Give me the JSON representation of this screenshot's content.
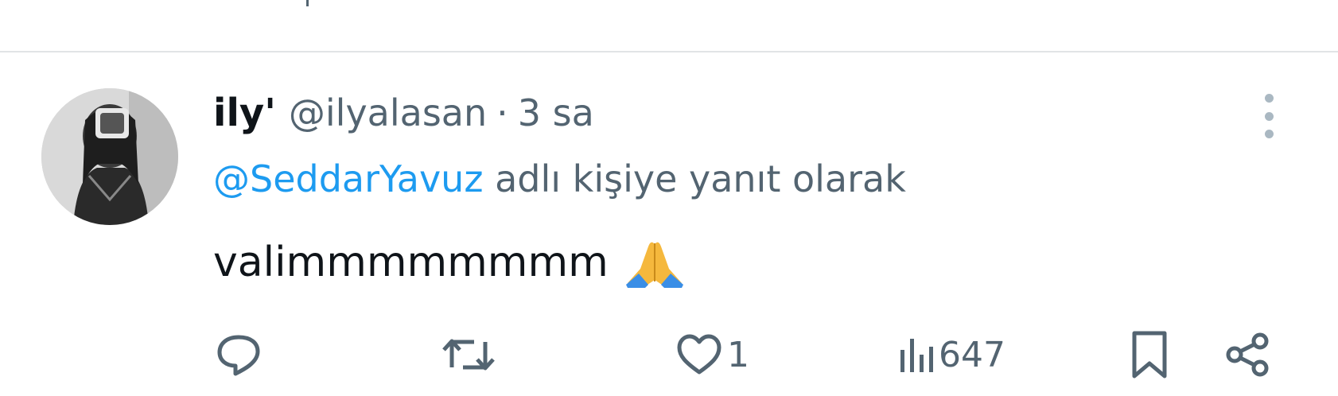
{
  "tweet": {
    "display_name": "ily'",
    "handle": "@ilyalasan",
    "separator": "·",
    "time": "3 sa",
    "reply_mention": "@SeddarYavuz",
    "reply_suffix": "adlı kişiye yanıt olarak",
    "text": "valimmmmmmmm",
    "emoji": "folded-hands-emoji"
  },
  "actions": {
    "reply_icon": "comment-icon",
    "retweet_icon": "retweet-icon",
    "like_icon": "heart-icon",
    "like_count": "1",
    "views_icon": "analytics-icon",
    "views_count": "647",
    "bookmark_icon": "bookmark-icon",
    "share_icon": "share-icon"
  },
  "colors": {
    "mention": "#1d9bf0",
    "secondary_text": "#536471",
    "primary_text": "#0f1419",
    "divider": "#e1e4e6"
  }
}
